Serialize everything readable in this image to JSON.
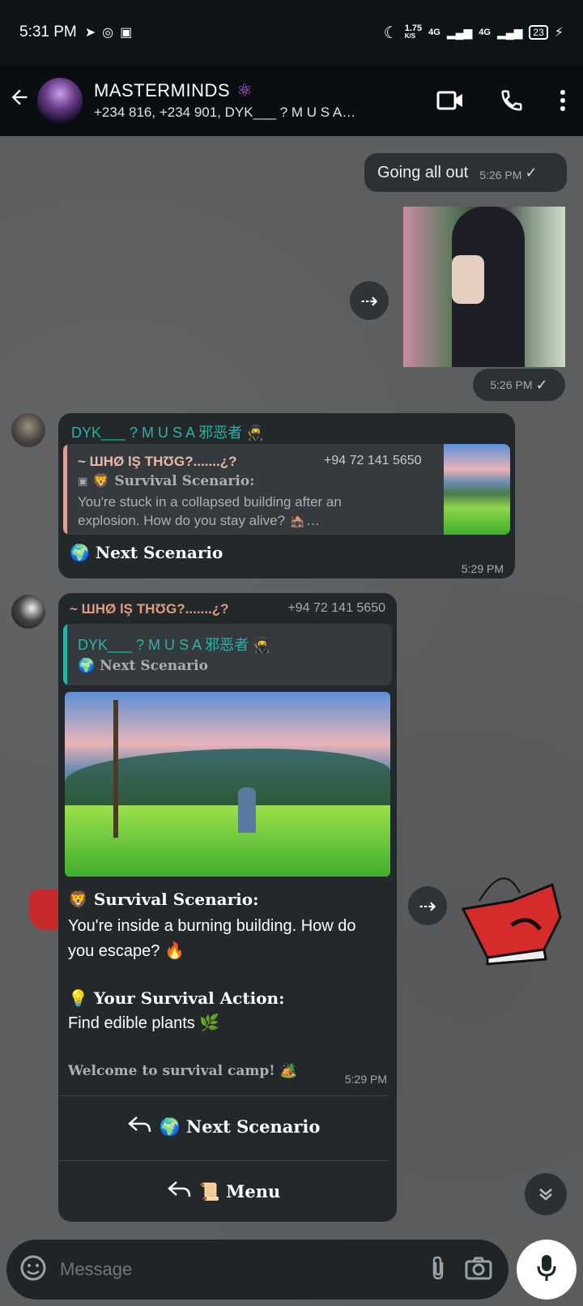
{
  "status_bar": {
    "time": "5:31 PM",
    "speed": "1.75",
    "speed_unit": "K/S",
    "net1": "4G",
    "net2": "4G",
    "battery": "23"
  },
  "header": {
    "title": "MASTERMINDS",
    "subtitle": "+234 816, +234 901, DYK___ ? M U S A…"
  },
  "messages": {
    "m1": {
      "text": "Going all out",
      "time": "5:26 PM"
    },
    "m2": {
      "time": "5:26 PM"
    },
    "m3": {
      "sender": "DYK___ ? M U S A 邪恶者 🥷",
      "quote_sender": "~ ШHØ lŞ THƱG?.......¿?",
      "quote_phone": "+94 72 141 5650",
      "quote_title": "🦁 Survival Scenario:",
      "quote_body": "You're stuck in a collapsed building after an explosion. How do you stay alive? 🏚️…",
      "text": "🌍 Next Scenario",
      "time": "5:29 PM"
    },
    "m4": {
      "sender": "~ ШHØ lŞ THƱG?.......¿?",
      "phone": "+94 72 141 5650",
      "quote_sender": "DYK___ ? M U S A 邪恶者 🥷",
      "quote_text": "🌍 Next Scenario",
      "scenario_title": "🦁 Survival Scenario:",
      "scenario_body": "You're inside a burning building. How do you escape? 🔥",
      "action_title": "💡 Your Survival Action:",
      "action_body": "Find edible plants 🌿",
      "footer": "Welcome to survival camp! 🏕️",
      "time": "5:29 PM",
      "reply_buttons": [
        "🌍 Next Scenario",
        "📜 Menu"
      ]
    }
  },
  "input": {
    "placeholder": "Message"
  }
}
